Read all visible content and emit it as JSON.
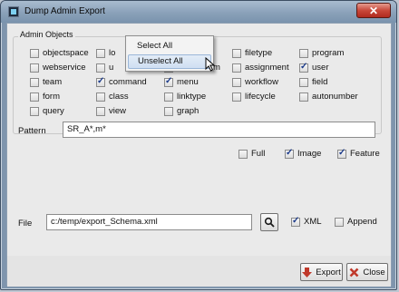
{
  "window": {
    "title": "Dump Admin Export",
    "close_glyph": "✕"
  },
  "admin_objects": {
    "label": "Admin Objects",
    "items": [
      {
        "label": "objectspace",
        "checked": false
      },
      {
        "label": "lo",
        "checked": false
      },
      {
        "label": "filetype",
        "checked": false
      },
      {
        "label": "program",
        "checked": false
      },
      {
        "label": "webservice",
        "checked": false
      },
      {
        "label": "u",
        "checked": false
      },
      {
        "label": "m",
        "checked": false
      },
      {
        "label": "assignment",
        "checked": false
      },
      {
        "label": "user",
        "checked": true
      },
      {
        "label": "team",
        "checked": false
      },
      {
        "label": "command",
        "checked": true
      },
      {
        "label": "menu",
        "checked": true
      },
      {
        "label": "workflow",
        "checked": false
      },
      {
        "label": "field",
        "checked": false
      },
      {
        "label": "form",
        "checked": false
      },
      {
        "label": "class",
        "checked": false
      },
      {
        "label": "linktype",
        "checked": false
      },
      {
        "label": "lifecycle",
        "checked": false
      },
      {
        "label": "autonumber",
        "checked": false
      },
      {
        "label": "query",
        "checked": false
      },
      {
        "label": "view",
        "checked": false
      },
      {
        "label": "graph",
        "checked": false
      }
    ]
  },
  "context_menu": {
    "items": [
      "Select All",
      "Unselect All"
    ]
  },
  "pattern": {
    "label": "Pattern",
    "value": "SR_A*,m*"
  },
  "options": [
    {
      "label": "Full",
      "checked": false
    },
    {
      "label": "Image",
      "checked": true
    },
    {
      "label": "Feature",
      "checked": true
    }
  ],
  "file": {
    "label": "File",
    "value": "c:/temp/export_Schema.xml",
    "xml": {
      "label": "XML",
      "checked": true
    },
    "append": {
      "label": "Append",
      "checked": false
    }
  },
  "buttons": {
    "export": "Export",
    "close": "Close"
  },
  "colors": {
    "titlebar": "#8aa1b9",
    "accent_red": "#c0392b",
    "check": "#1b3a8a"
  }
}
